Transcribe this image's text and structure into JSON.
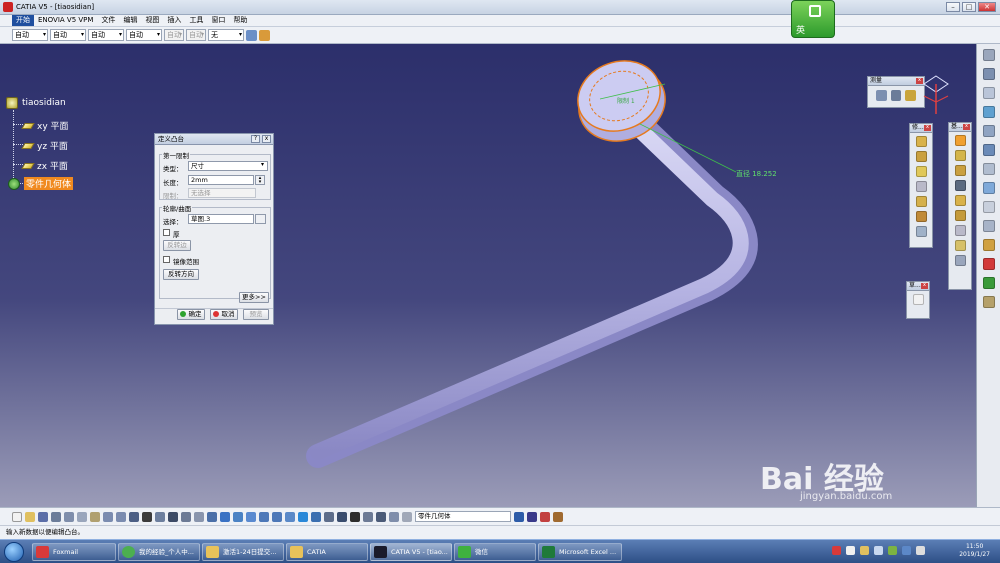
{
  "window": {
    "title": "CATIA V5 - [tiaosidian]",
    "controls": [
      "–",
      "□",
      "✕"
    ]
  },
  "menu": [
    "开始",
    "ENOVIA V5 VPM",
    "文件",
    "编辑",
    "视图",
    "插入",
    "工具",
    "窗口",
    "帮助"
  ],
  "select_toolbar": [
    "自动",
    "自动",
    "自动",
    "自动",
    "自动",
    "自动",
    "无"
  ],
  "ime_badge": "英",
  "tree": {
    "root": "tiaosidian",
    "items": [
      "xy 平面",
      "yz 平面",
      "zx 平面",
      "零件几何体"
    ]
  },
  "dialog": {
    "title": "定义凸台",
    "group1": "第一限制",
    "type_label": "类型：",
    "type_value": "尺寸",
    "length_label": "长度：",
    "length_value": "2mm",
    "limit_label": "限制：",
    "limit_value": "无选择",
    "group2": "轮廓/曲面",
    "select_label": "选择：",
    "select_value": "草图.3",
    "thick_label": "厚",
    "reverse_side": "反转边",
    "mirror_label": "镜像范围",
    "reverse_dir": "反转方向",
    "more": "更多>>",
    "ok": "确定",
    "cancel": "取消",
    "preview": "预览"
  },
  "viewport": {
    "dim_label": "直径 18.252",
    "limit_label": "限制 1"
  },
  "measure_toolbar": {
    "title": "测量"
  },
  "toolbars": {
    "tb1": "修...",
    "tb2": "基...",
    "tb3": "草..."
  },
  "bottom": {
    "body_select": "零件几何体"
  },
  "status": {
    "text": "输入新数据以便编辑凸台。"
  },
  "taskbar": {
    "items": [
      "Foxmail",
      "我的经验_个人中...",
      "激活1-24日提交...",
      "CATIA",
      "CATIA V5 - [tiao...",
      "微信",
      "Microsoft Excel ..."
    ],
    "time": "11:50",
    "date": "2019/1/27"
  },
  "watermark": {
    "brand": "Bai 经验",
    "url": "jingyan.baidu.com"
  },
  "colors": {
    "viewport_top": "#2c2f6b",
    "highlight": "#f08a20",
    "pipe": "#b8b7e6",
    "dim_green": "#3fbf4a"
  }
}
